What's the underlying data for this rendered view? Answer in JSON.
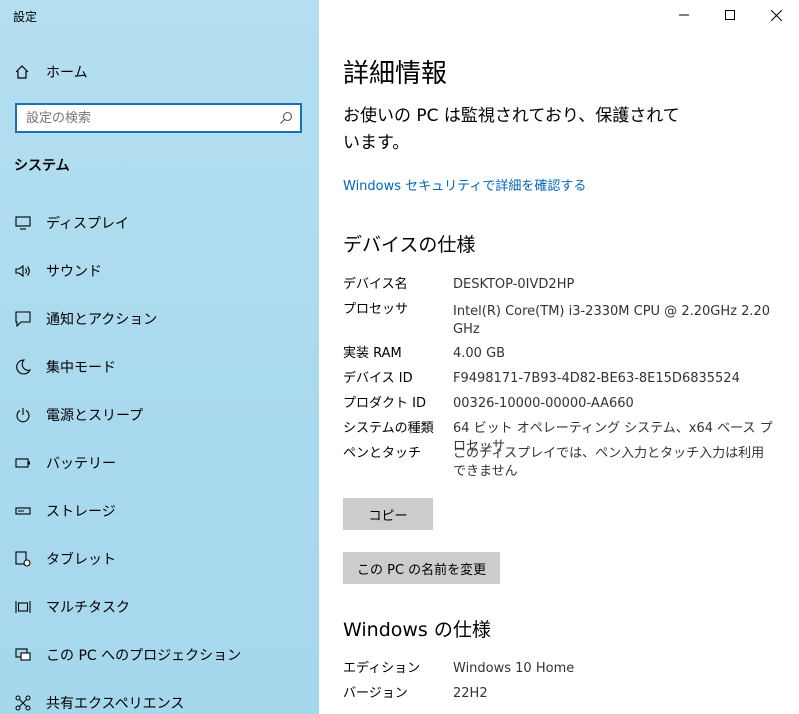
{
  "app": {
    "title": "設定"
  },
  "sidebar": {
    "home_label": "ホーム",
    "search_placeholder": "設定の検索",
    "section_title": "システム",
    "items": [
      {
        "label": "ディスプレイ",
        "icon": "display-icon"
      },
      {
        "label": "サウンド",
        "icon": "sound-icon"
      },
      {
        "label": "通知とアクション",
        "icon": "notification-icon"
      },
      {
        "label": "集中モード",
        "icon": "moon-icon"
      },
      {
        "label": "電源とスリープ",
        "icon": "power-icon"
      },
      {
        "label": "バッテリー",
        "icon": "battery-icon"
      },
      {
        "label": "ストレージ",
        "icon": "storage-icon"
      },
      {
        "label": "タブレット",
        "icon": "tablet-icon"
      },
      {
        "label": "マルチタスク",
        "icon": "multitask-icon"
      },
      {
        "label": "この PC へのプロジェクション",
        "icon": "projection-icon"
      },
      {
        "label": "共有エクスペリエンス",
        "icon": "share-icon"
      }
    ]
  },
  "main": {
    "heading": "詳細情報",
    "status_text": "お使いの PC は監視されており、保護されています。",
    "security_link": "Windows セキュリティで詳細を確認する",
    "device_spec_title": "デバイスの仕様",
    "device_specs": [
      {
        "key": "デバイス名",
        "value": "DESKTOP-0IVD2HP"
      },
      {
        "key": "プロセッサ",
        "value": "Intel(R) Core(TM) i3-2330M CPU @ 2.20GHz   2.20 GHz"
      },
      {
        "key": "実装 RAM",
        "value": "4.00 GB"
      },
      {
        "key": "デバイス ID",
        "value": "F9498171-7B93-4D82-BE63-8E15D6835524"
      },
      {
        "key": "プロダクト ID",
        "value": "00326-10000-00000-AA660"
      },
      {
        "key": "システムの種類",
        "value": "64 ビット オペレーティング システム、x64 ベース プロセッサ"
      },
      {
        "key": "ペンとタッチ",
        "value": "このディスプレイでは、ペン入力とタッチ入力は利用できません"
      }
    ],
    "copy_button": "コピー",
    "rename_button": "この PC の名前を変更",
    "windows_spec_title": "Windows の仕様",
    "windows_specs": [
      {
        "key": "エディション",
        "value": "Windows 10 Home"
      },
      {
        "key": "バージョン",
        "value": "22H2"
      }
    ]
  },
  "colors": {
    "accent": "#0067b8",
    "sidebar_bg": "#a9d9ee",
    "button_bg": "#cccccc"
  }
}
